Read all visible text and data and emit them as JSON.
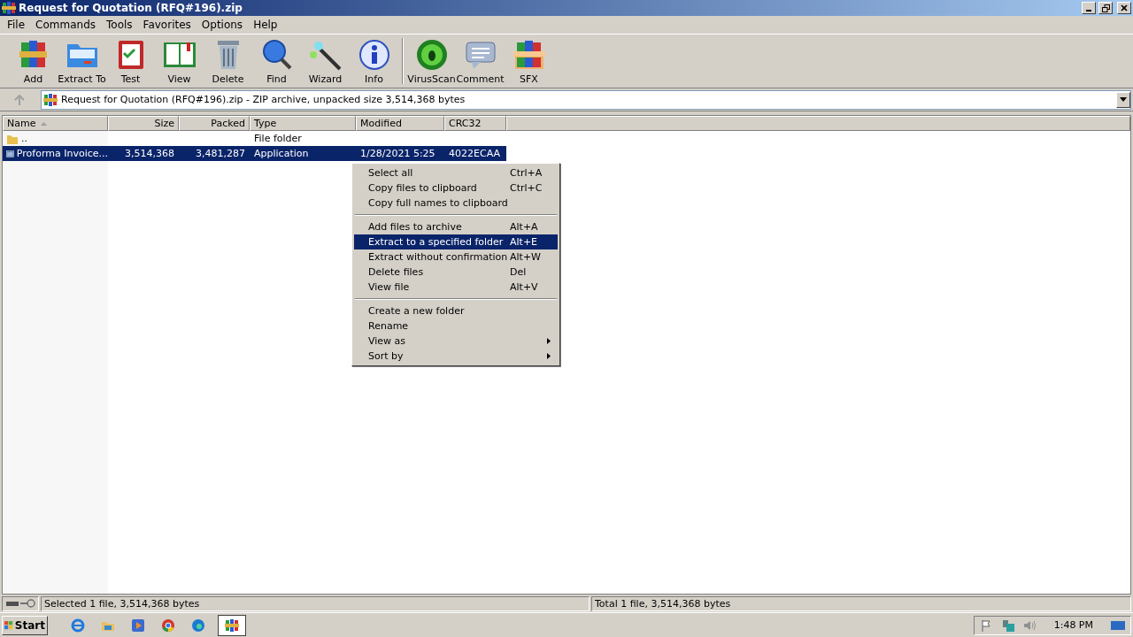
{
  "window": {
    "title": "Request for Quotation (RFQ#196).zip"
  },
  "menu": [
    "File",
    "Commands",
    "Tools",
    "Favorites",
    "Options",
    "Help"
  ],
  "toolbar": {
    "groups": [
      [
        {
          "label": "Add"
        },
        {
          "label": "Extract To"
        },
        {
          "label": "Test"
        },
        {
          "label": "View"
        },
        {
          "label": "Delete"
        },
        {
          "label": "Find"
        },
        {
          "label": "Wizard"
        },
        {
          "label": "Info"
        }
      ],
      [
        {
          "label": "VirusScan"
        },
        {
          "label": "Comment"
        },
        {
          "label": "SFX"
        }
      ]
    ]
  },
  "address": {
    "text": "Request for Quotation (RFQ#196).zip - ZIP archive, unpacked size 3,514,368 bytes"
  },
  "columns": [
    {
      "label": "Name",
      "sorted": true
    },
    {
      "label": "Size",
      "sorted": false
    },
    {
      "label": "Packed",
      "sorted": false
    },
    {
      "label": "Type",
      "sorted": false
    },
    {
      "label": "Modified",
      "sorted": false
    },
    {
      "label": "CRC32",
      "sorted": false
    }
  ],
  "rows": [
    {
      "kind": "folder",
      "cells": [
        "..",
        "",
        "",
        "File folder",
        "",
        ""
      ],
      "selected": false
    },
    {
      "kind": "file",
      "cells": [
        "Proforma Invoice...",
        "3,514,368",
        "3,481,287",
        "Application",
        "1/28/2021 5:25",
        "4022ECAA"
      ],
      "selected": true
    }
  ],
  "context_menu": {
    "groups": [
      [
        {
          "label": "Select all",
          "shortcut": "Ctrl+A",
          "selected": false,
          "submenu": false
        },
        {
          "label": "Copy files to clipboard",
          "shortcut": "Ctrl+C",
          "selected": false,
          "submenu": false
        },
        {
          "label": "Copy full names to clipboard",
          "selected": false,
          "submenu": false
        }
      ],
      [
        {
          "label": "Add files to archive",
          "shortcut": "Alt+A",
          "selected": false,
          "submenu": false
        },
        {
          "label": "Extract to a specified folder",
          "shortcut": "Alt+E",
          "selected": true,
          "submenu": false
        },
        {
          "label": "Extract without confirmation",
          "shortcut": "Alt+W",
          "selected": false,
          "submenu": false
        },
        {
          "label": "Delete files",
          "shortcut": "Del",
          "selected": false,
          "submenu": false
        },
        {
          "label": "View file",
          "shortcut": "Alt+V",
          "selected": false,
          "submenu": false
        }
      ],
      [
        {
          "label": "Create a new folder",
          "selected": false,
          "submenu": false
        },
        {
          "label": "Rename",
          "selected": false,
          "submenu": false
        },
        {
          "label": "View as",
          "selected": false,
          "submenu": true
        },
        {
          "label": "Sort by",
          "selected": false,
          "submenu": true
        }
      ]
    ]
  },
  "status_bar": {
    "left": "Selected 1 file, 3,514,368 bytes",
    "right": "Total 1 file, 3,514,368 bytes"
  },
  "taskbar": {
    "start": "Start",
    "apps": [
      {
        "kind": "ie",
        "selected": false
      },
      {
        "kind": "explorer",
        "selected": false
      },
      {
        "kind": "media",
        "selected": false
      },
      {
        "kind": "chrome",
        "selected": false
      },
      {
        "kind": "edge",
        "selected": false
      },
      {
        "kind": "winrar",
        "selected": true
      }
    ],
    "clock": "1:48 PM"
  }
}
